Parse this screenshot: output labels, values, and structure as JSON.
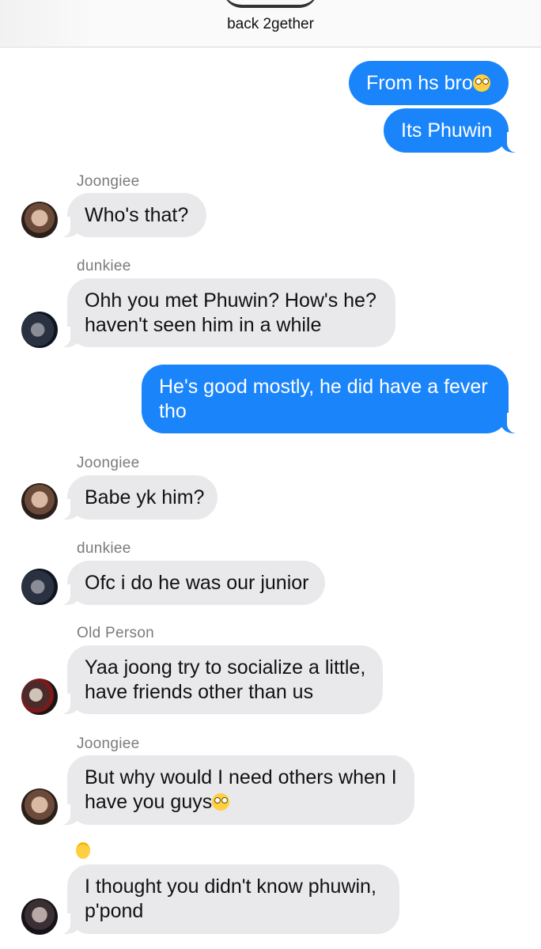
{
  "header": {
    "title": "back 2gether"
  },
  "messages": [
    {
      "text": "From hs bro",
      "emoji": "face-with-rolling-eyes"
    },
    {
      "text": "Its Phuwin"
    },
    {
      "sender": "Joongiee",
      "text": "Who's that?"
    },
    {
      "sender": "dunkiee",
      "lines": [
        "Ohh you met Phuwin? How's he?",
        "haven't seen him in a while"
      ]
    },
    {
      "lines": [
        "He's good mostly, he did have a fever",
        "tho"
      ]
    },
    {
      "sender": "Joongiee",
      "text": "Babe yk him?"
    },
    {
      "sender": "dunkiee",
      "text": "Ofc i do he was our junior"
    },
    {
      "sender": "Old Person",
      "lines": [
        "Yaa joong try to socialize a little,",
        "have friends other than us"
      ]
    },
    {
      "sender": "Joongiee",
      "lines": [
        "But why would I need others when I",
        "have you guys"
      ],
      "emoji": "pleading-face"
    },
    {
      "sender_icon": "smiling-face-with-halo",
      "lines": [
        "I thought you didn't know phuwin,",
        "p'pond"
      ]
    }
  ]
}
